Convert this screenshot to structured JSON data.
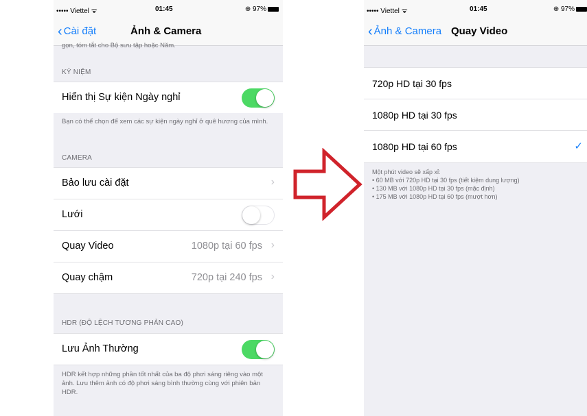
{
  "left": {
    "status": {
      "carrier": "••••• Viettel ᯤ",
      "time": "01:45",
      "battery": "⊕ 97%"
    },
    "nav": {
      "back": "Cài đặt",
      "title": "Ảnh & Camera"
    },
    "truncated_text": "gọn, tóm tắt cho Bộ sưu tập hoặc Năm.",
    "section_memories": "KỶ NIỆM",
    "holiday_label": "Hiển thị Sự kiện Ngày nghỉ",
    "holiday_footer": "Bạn có thể chọn để xem các sự kiện ngày nghỉ ở quê hương của mình.",
    "section_camera": "CAMERA",
    "preserve_label": "Bảo lưu cài đặt",
    "grid_label": "Lưới",
    "video_label": "Quay Video",
    "video_value": "1080p tại 60 fps",
    "slomo_label": "Quay chậm",
    "slomo_value": "720p tại 240 fps",
    "section_hdr": "HDR (ĐỘ LỆCH TƯƠNG PHẢN CAO)",
    "keep_label": "Lưu Ảnh Thường",
    "hdr_footer": "HDR kết hợp những phần tốt nhất của ba độ phơi sáng riêng vào một ảnh. Lưu thêm ảnh có độ phơi sáng bình thường cùng với phiên bản HDR."
  },
  "right": {
    "status": {
      "carrier": "••••• Viettel ᯤ",
      "time": "01:45",
      "battery": "⊕ 97%"
    },
    "nav": {
      "back": "Ảnh & Camera",
      "title": "Quay Video"
    },
    "options": [
      "720p HD tại 30 fps",
      "1080p HD tại 30 fps",
      "1080p HD tại 60 fps"
    ],
    "footer_title": "Một phút video sẽ xấp xỉ:",
    "footer_lines": [
      "• 60 MB với 720p HD tại 30 fps (tiết kiệm dung lượng)",
      "• 130 MB với 1080p HD tại 30 fps (mặc định)",
      "• 175 MB với 1080p HD tại 60 fps (mượt hơn)"
    ]
  },
  "icons": {
    "arrow": "red-outline-arrow-right-icon",
    "check": "checkmark-icon",
    "chevron": "chevron-right-icon",
    "back": "chevron-left-icon"
  },
  "colors": {
    "accent": "#147efb",
    "toggle_on": "#4cd964",
    "arrow": "#d0232b"
  }
}
